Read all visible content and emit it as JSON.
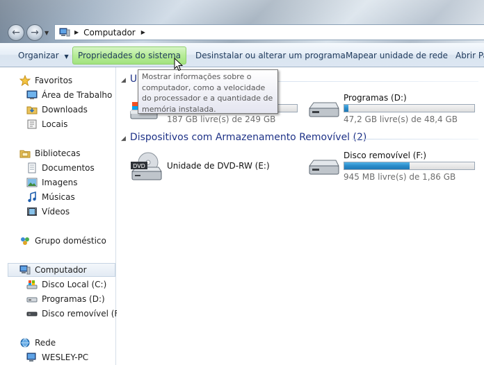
{
  "window": {
    "address_crumb": "Computador"
  },
  "toolbar": {
    "organize": "Organizar",
    "organize_arrow": "▼",
    "system_properties": "Propriedades do sistema",
    "uninstall": "Desinstalar ou alterar um programa",
    "map_drive": "Mapear unidade de rede",
    "open": "Abrir Pa"
  },
  "tooltip": {
    "text": "Mostrar informações sobre o computador, como a velocidade do processador e a quantidade de memória instalada."
  },
  "navpane": {
    "favorites": {
      "label": "Favoritos",
      "items": [
        "Área de Trabalho",
        "Downloads",
        "Locais"
      ]
    },
    "libraries": {
      "label": "Bibliotecas",
      "items": [
        "Documentos",
        "Imagens",
        "Músicas",
        "Vídeos"
      ]
    },
    "homegroup": "Grupo doméstico",
    "computer": {
      "label": "Computador",
      "items": [
        "Disco Local (C:)",
        "Programas (D:)",
        "Disco removível (F:)"
      ]
    },
    "network": {
      "label": "Rede",
      "items": [
        "WESLEY-PC"
      ]
    }
  },
  "content": {
    "hard_disks_header_partial": "U",
    "removable_header": "Dispositivos com Armazenamento Removível (2)",
    "drives": [
      {
        "name": "",
        "free_text": "187 GB livre(s) de 249 GB",
        "used_fraction": 0.25
      },
      {
        "name": "Programas (D:)",
        "free_text": "47,2 GB livre(s) de 48,4 GB",
        "used_fraction": 0.03
      },
      {
        "name": "Unidade de DVD-RW (E:)"
      },
      {
        "name": "Disco removível (F:)",
        "free_text": "945 MB livre(s) de 1,86 GB",
        "used_fraction": 0.5
      }
    ],
    "dvd_label": "DVD"
  },
  "colors": {
    "accent_header": "#1e3287",
    "bar_fill": "#2a8bc9",
    "toolbar_hover": "#b6ec97"
  }
}
